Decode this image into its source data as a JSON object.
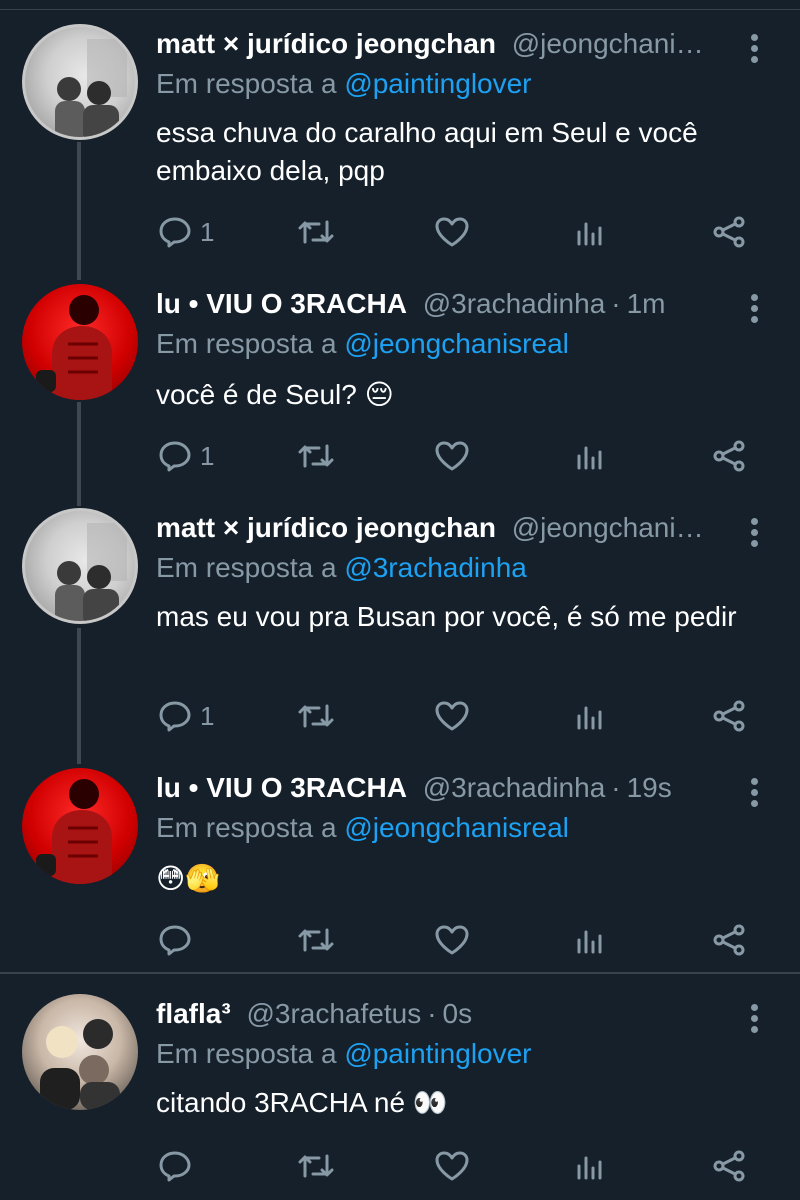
{
  "tweets": [
    {
      "author_name": "matt × jurídico jeongchan",
      "handle": "@jeongchani…",
      "time": "",
      "reply_prefix": "Em resposta a",
      "reply_to": "@paintinglover",
      "text": "essa chuva do caralho aqui em Seul e você embaixo dela, pqp",
      "reply_count": "1",
      "avatar": "gray"
    },
    {
      "author_name": "lu • VIU O 3RACHA",
      "handle": "@3rachadinha",
      "time": "1m",
      "reply_prefix": "Em resposta a",
      "reply_to": "@jeongchanisreal",
      "text": "você é de Seul? 😔",
      "reply_count": "1",
      "avatar": "red"
    },
    {
      "author_name": "matt × jurídico jeongchan",
      "handle": "@jeongchani…",
      "time": "",
      "reply_prefix": "Em resposta a",
      "reply_to": "@3rachadinha",
      "text": "mas eu vou pra Busan por você, é só me pedir",
      "reply_count": "1",
      "avatar": "gray"
    },
    {
      "author_name": "lu • VIU O 3RACHA",
      "handle": "@3rachadinha",
      "time": "19s",
      "reply_prefix": "Em resposta a",
      "reply_to": "@jeongchanisreal",
      "text": "😳🫣",
      "reply_count": "",
      "avatar": "red"
    },
    {
      "author_name": "flafla³",
      "handle": "@3rachafetus",
      "time": "0s",
      "reply_prefix": "Em resposta a",
      "reply_to": "@paintinglover",
      "text": "citando 3RACHA né 👀",
      "reply_count": "",
      "avatar": "group"
    }
  ],
  "icons": {
    "reply": "reply-icon",
    "retweet": "retweet-icon",
    "like": "heart-icon",
    "analytics": "analytics-icon",
    "share": "share-icon",
    "more": "more-vertical-icon"
  },
  "colors": {
    "background": "#15202b",
    "text_primary": "#ffffff",
    "text_secondary": "#8899a6",
    "link": "#1da1f2",
    "divider": "#38444d"
  }
}
